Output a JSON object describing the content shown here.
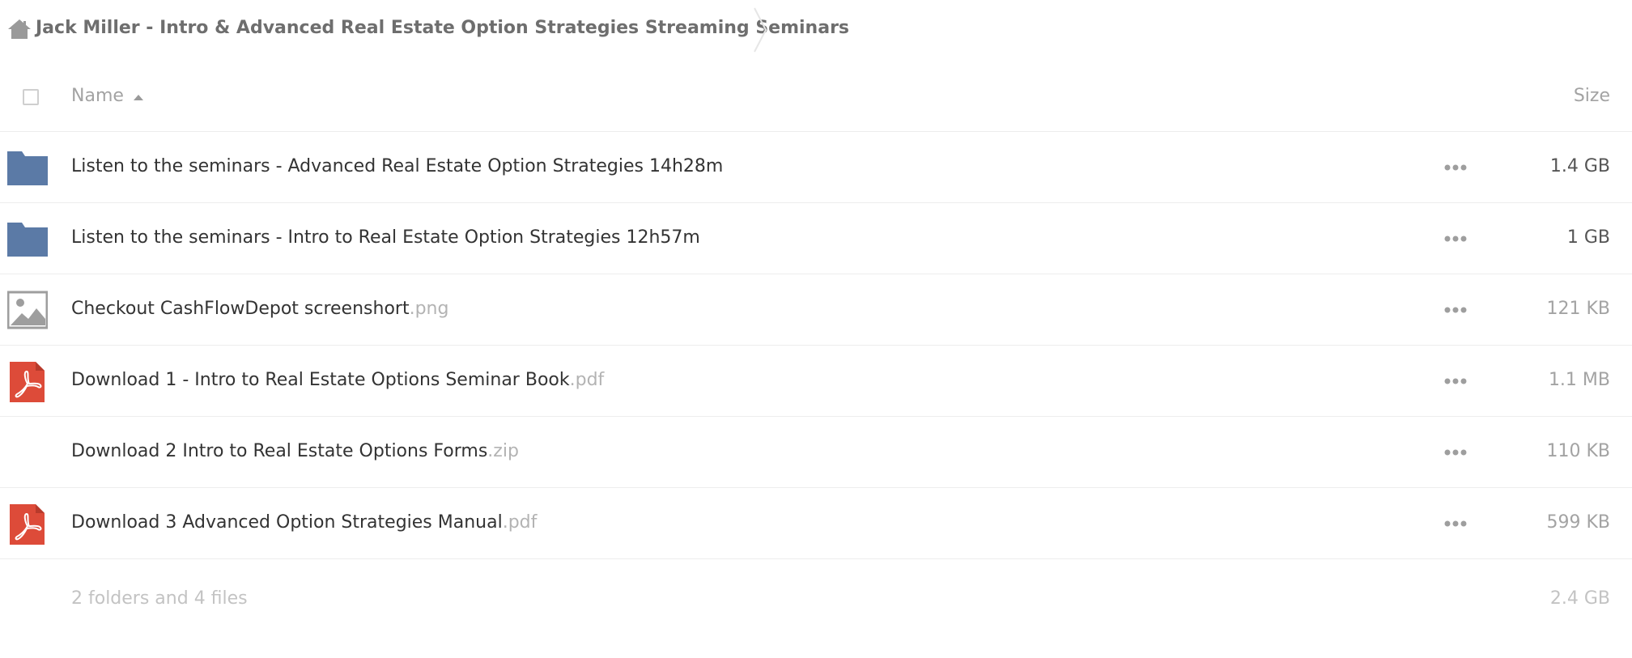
{
  "breadcrumb": {
    "home_icon": "home-icon",
    "title": "Jack Miller - Intro & Advanced Real Estate Option Strategies Streaming Seminars"
  },
  "header": {
    "name_label": "Name",
    "size_label": "Size",
    "sort_direction": "ascending"
  },
  "files": [
    {
      "base": "Listen to the seminars - Advanced Real Estate Option Strategies 14h28m",
      "ext": "",
      "size": "1.4 GB",
      "icon": "folder-icon",
      "size_style": "dark"
    },
    {
      "base": "Listen to the seminars - Intro to Real Estate Option Strategies 12h57m",
      "ext": "",
      "size": "1 GB",
      "icon": "folder-icon",
      "size_style": "dark"
    },
    {
      "base": "Checkout CashFlowDepot screenshort",
      "ext": ".png",
      "size": "121 KB",
      "icon": "image-file-icon",
      "size_style": "light"
    },
    {
      "base": "Download 1 - Intro to Real Estate Options Seminar Book",
      "ext": ".pdf",
      "size": "1.1 MB",
      "icon": "pdf-file-icon",
      "size_style": "light"
    },
    {
      "base": "Download 2 Intro to Real Estate Options Forms",
      "ext": ".zip",
      "size": "110 KB",
      "icon": "none",
      "size_style": "light"
    },
    {
      "base": "Download 3 Advanced Option Strategies Manual",
      "ext": ".pdf",
      "size": "599 KB",
      "icon": "pdf-file-icon",
      "size_style": "light"
    }
  ],
  "summary": {
    "count_text": "2 folders and 4 files",
    "total_size": "2.4 GB"
  },
  "colors": {
    "folder": "#5b7aa6",
    "pdf": "#dd4b39",
    "image": "#9e9e9e",
    "text_muted": "#a3a3a3",
    "divider": "#ededed"
  }
}
